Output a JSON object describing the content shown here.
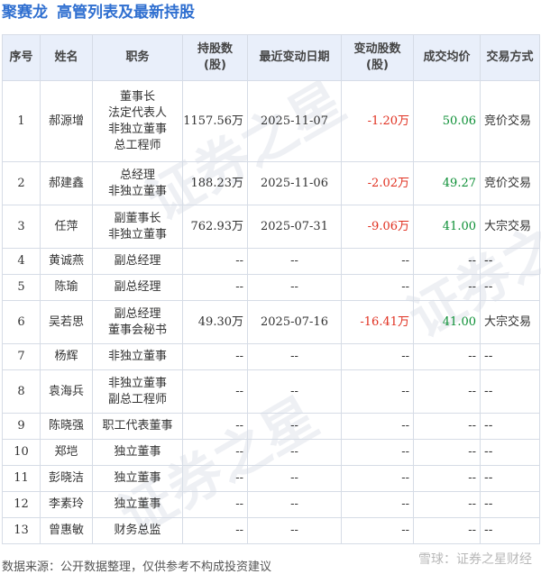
{
  "header": {
    "company": "聚赛龙",
    "title": "高管列表及最新持股"
  },
  "table": {
    "columns": [
      "序号",
      "姓名",
      "职务",
      "持股数\n(股)",
      "最近变动日期",
      "变动股数\n(股)",
      "成交均价",
      "交易方式"
    ],
    "rows": [
      {
        "no": "1",
        "name": "郝源增",
        "position": "董事长\n法定代表人\n非独立董事\n总工程师",
        "shares": "1157.56万",
        "date": "2025-11-07",
        "change": "-1.20万",
        "price": "50.06",
        "method": "竞价交易"
      },
      {
        "no": "2",
        "name": "郝建鑫",
        "position": "总经理\n非独立董事",
        "shares": "188.23万",
        "date": "2025-11-06",
        "change": "-2.02万",
        "price": "49.27",
        "method": "竞价交易"
      },
      {
        "no": "3",
        "name": "任萍",
        "position": "副董事长\n非独立董事",
        "shares": "762.93万",
        "date": "2025-07-31",
        "change": "-9.06万",
        "price": "41.00",
        "method": "大宗交易"
      },
      {
        "no": "4",
        "name": "黄诚燕",
        "position": "副总经理",
        "shares": "--",
        "date": "--",
        "change": "--",
        "price": "--",
        "method": "--"
      },
      {
        "no": "5",
        "name": "陈瑜",
        "position": "副总经理",
        "shares": "--",
        "date": "--",
        "change": "--",
        "price": "--",
        "method": "--"
      },
      {
        "no": "6",
        "name": "吴若思",
        "position": "副总经理\n董事会秘书",
        "shares": "49.30万",
        "date": "2025-07-16",
        "change": "-16.41万",
        "price": "41.00",
        "method": "大宗交易"
      },
      {
        "no": "7",
        "name": "杨辉",
        "position": "非独立董事",
        "shares": "--",
        "date": "--",
        "change": "--",
        "price": "--",
        "method": "--"
      },
      {
        "no": "8",
        "name": "袁海兵",
        "position": "非独立董事\n副总工程师",
        "shares": "--",
        "date": "--",
        "change": "--",
        "price": "--",
        "method": "--"
      },
      {
        "no": "9",
        "name": "陈晓强",
        "position": "职工代表董事",
        "shares": "--",
        "date": "--",
        "change": "--",
        "price": "--",
        "method": "--"
      },
      {
        "no": "10",
        "name": "郑垲",
        "position": "独立董事",
        "shares": "--",
        "date": "--",
        "change": "--",
        "price": "--",
        "method": "--"
      },
      {
        "no": "11",
        "name": "彭晓洁",
        "position": "独立董事",
        "shares": "--",
        "date": "--",
        "change": "--",
        "price": "--",
        "method": "--"
      },
      {
        "no": "12",
        "name": "李素玲",
        "position": "独立董事",
        "shares": "--",
        "date": "--",
        "change": "--",
        "price": "--",
        "method": "--"
      },
      {
        "no": "13",
        "name": "曾惠敏",
        "position": "财务总监",
        "shares": "--",
        "date": "--",
        "change": "--",
        "price": "--",
        "method": "--"
      }
    ]
  },
  "footer": {
    "source": "数据来源：公开数据整理，仅供参考不构成投资建议",
    "brand": "雪球：证券之星财经"
  },
  "watermark": {
    "text": "证券之星"
  },
  "colors": {
    "title": "#2f6fd0",
    "header_bg": "#e9effa",
    "negative": "#e03020",
    "price": "#0c8f35"
  }
}
